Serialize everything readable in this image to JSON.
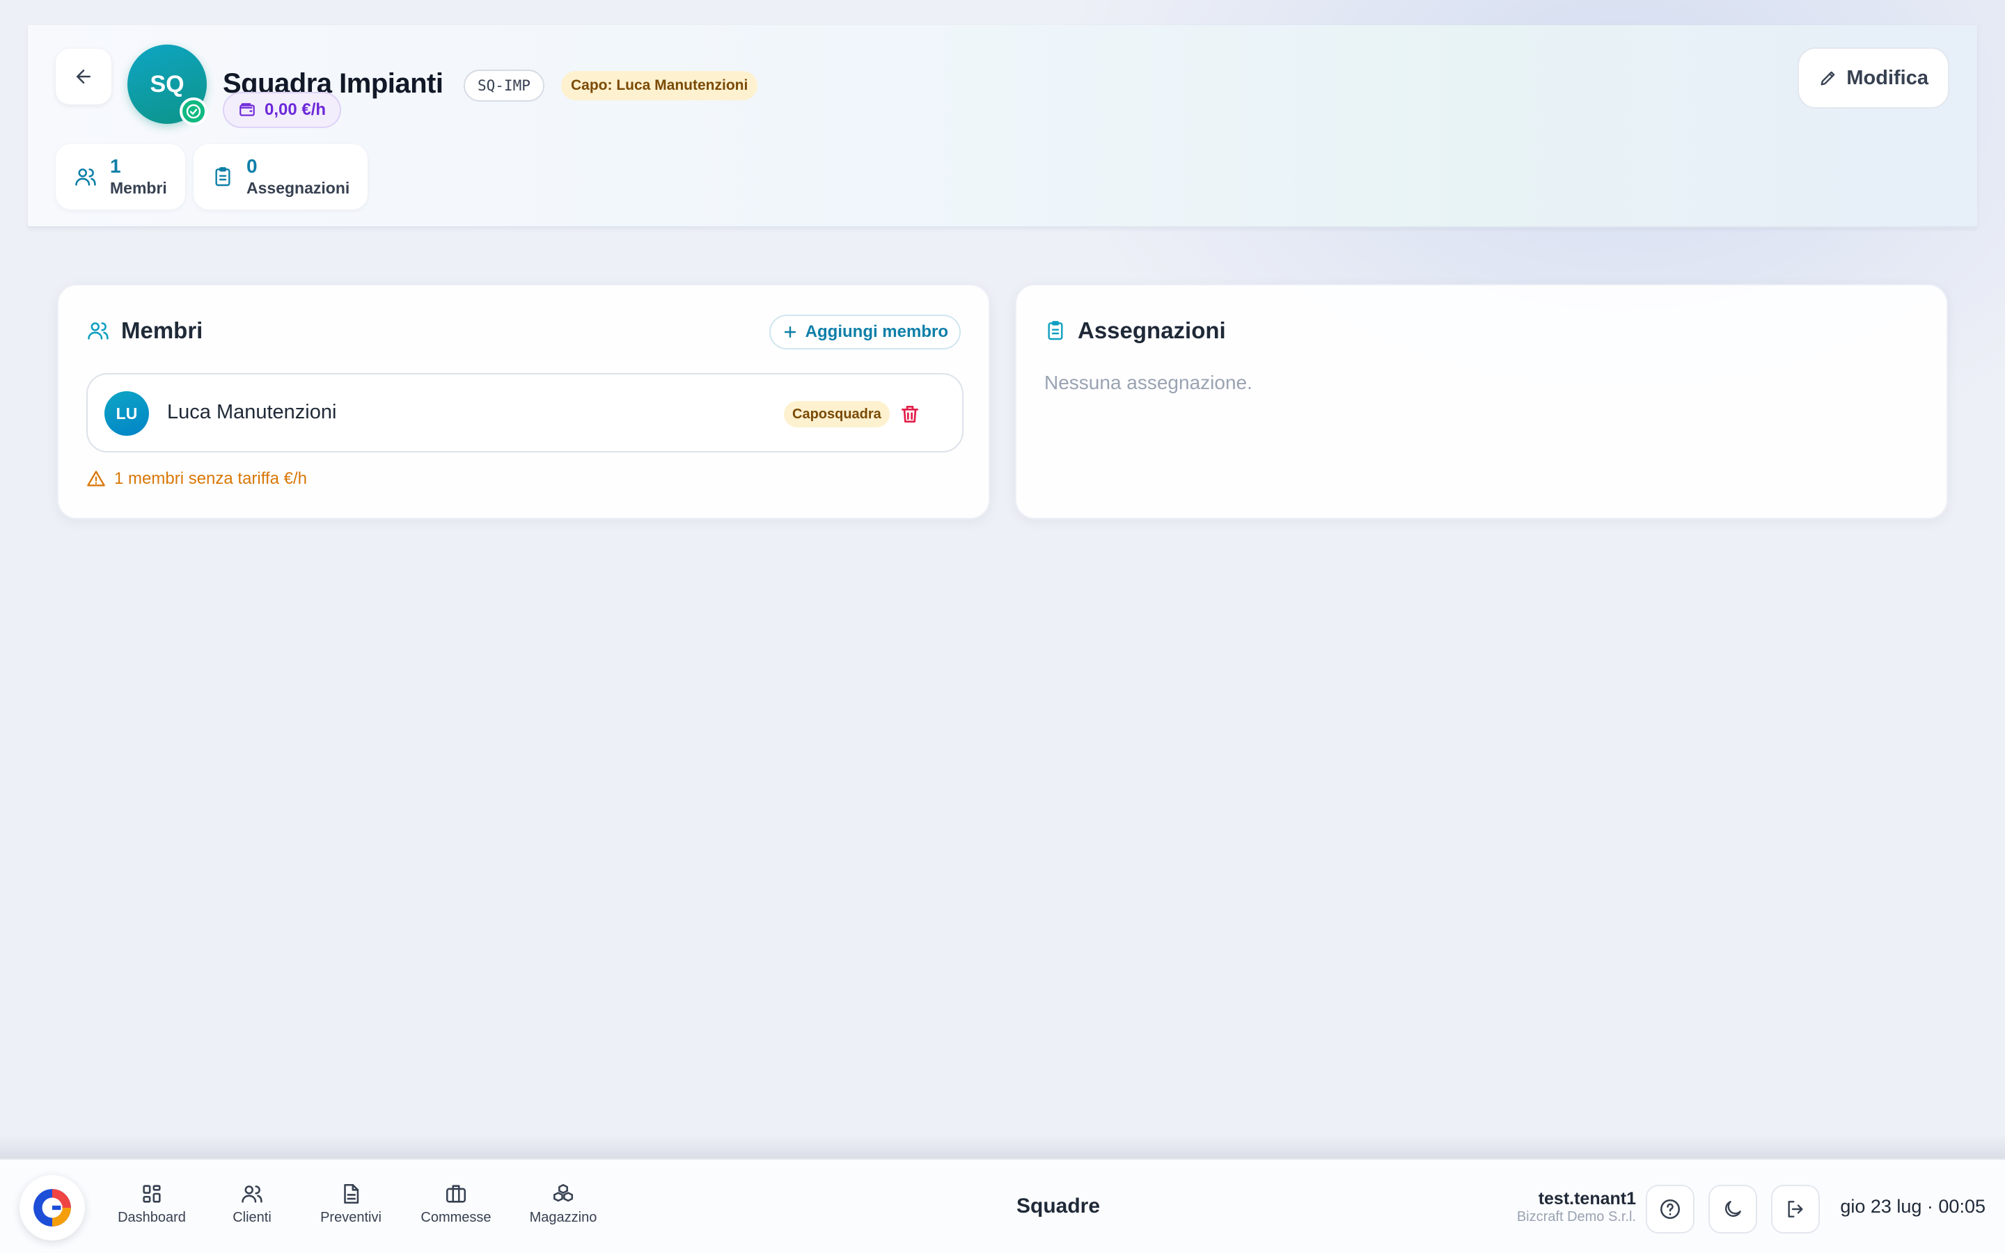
{
  "header": {
    "avatar_initials": "SQ",
    "title": "Squadra Impianti",
    "code": "SQ-IMP",
    "capo_label": "Capo: Luca Manutenzioni",
    "rate": "0,00 €/h",
    "edit_label": "Modifica",
    "stats": [
      {
        "value": "1",
        "label": "Membri",
        "icon": "users-icon"
      },
      {
        "value": "0",
        "label": "Assegnazioni",
        "icon": "clipboard-icon"
      }
    ]
  },
  "members_card": {
    "title": "Membri",
    "add_label": "Aggiungi membro",
    "members": [
      {
        "initials": "LU",
        "name": "Luca Manutenzioni",
        "role": "Caposquadra"
      }
    ],
    "warning": "1 membri senza tariffa €/h"
  },
  "assignments_card": {
    "title": "Assegnazioni",
    "empty": "Nessuna assegnazione."
  },
  "bottombar": {
    "nav": [
      {
        "label": "Dashboard",
        "icon": "grid-icon"
      },
      {
        "label": "Clienti",
        "icon": "users-icon"
      },
      {
        "label": "Preventivi",
        "icon": "document-icon"
      },
      {
        "label": "Commesse",
        "icon": "briefcase-icon"
      },
      {
        "label": "Magazzino",
        "icon": "boxes-icon"
      }
    ],
    "section": "Squadre",
    "user": "test.tenant1",
    "company": "Bizcraft Demo S.r.l.",
    "clock": "gio 23 lug · 00:05"
  },
  "colors": {
    "accent": "#0e7fa8",
    "avatar_gradient_start": "#0ea5c4",
    "avatar_gradient_end": "#0d9488",
    "rate": "#6d28d9",
    "warning": "#d97706",
    "danger": "#e11d48",
    "badge_amber_bg": "#fdf1cf"
  }
}
